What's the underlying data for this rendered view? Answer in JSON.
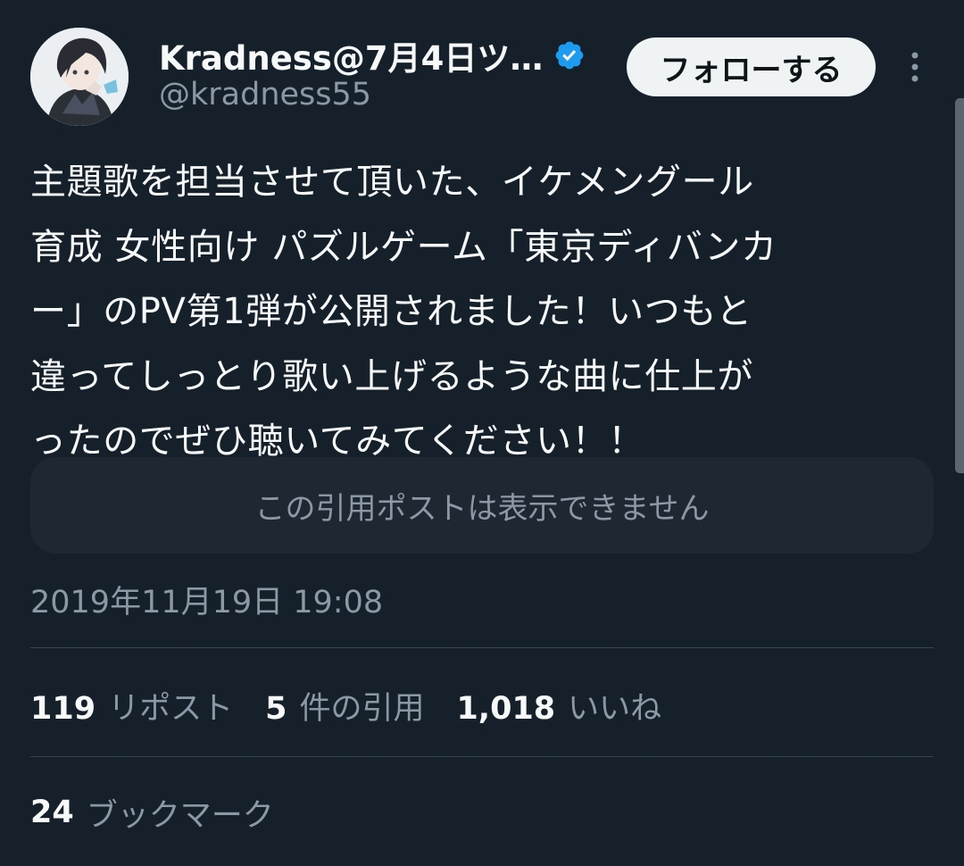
{
  "author": {
    "display_name": "Kradness@7月4日ツ…",
    "handle": "@kradness55",
    "verified": true,
    "avatar": "avatar"
  },
  "header": {
    "follow_label": "フォローする",
    "more_icon": "more-vertical-icon"
  },
  "tweet": {
    "text_lines": [
      "主題歌を担当させて頂いた、イケメングール",
      "育成 女性向け パズルゲーム「東京ディバンカ",
      "ー」のPV第1弾が公開されました！いつもと",
      "違ってしっとり歌い上げるような曲に仕上が",
      "ったのでぜひ聴いてみてください！！"
    ],
    "quote_unavailable": "この引用ポストは表示できません",
    "timestamp": "2019年11月19日 19:08"
  },
  "stats": {
    "reposts": {
      "count": "119",
      "label": "リポスト"
    },
    "quotes": {
      "count": "5",
      "label": "件の引用"
    },
    "likes": {
      "count": "1,018",
      "label": "いいね"
    },
    "bookmarks": {
      "count": "24",
      "label": "ブックマーク"
    }
  },
  "colors": {
    "background": "#15202b",
    "text": "#f7f9f9",
    "muted": "#8b98a5",
    "verified": "#1d9bf0",
    "divider": "#38444d",
    "button_bg": "#eff3f4"
  }
}
